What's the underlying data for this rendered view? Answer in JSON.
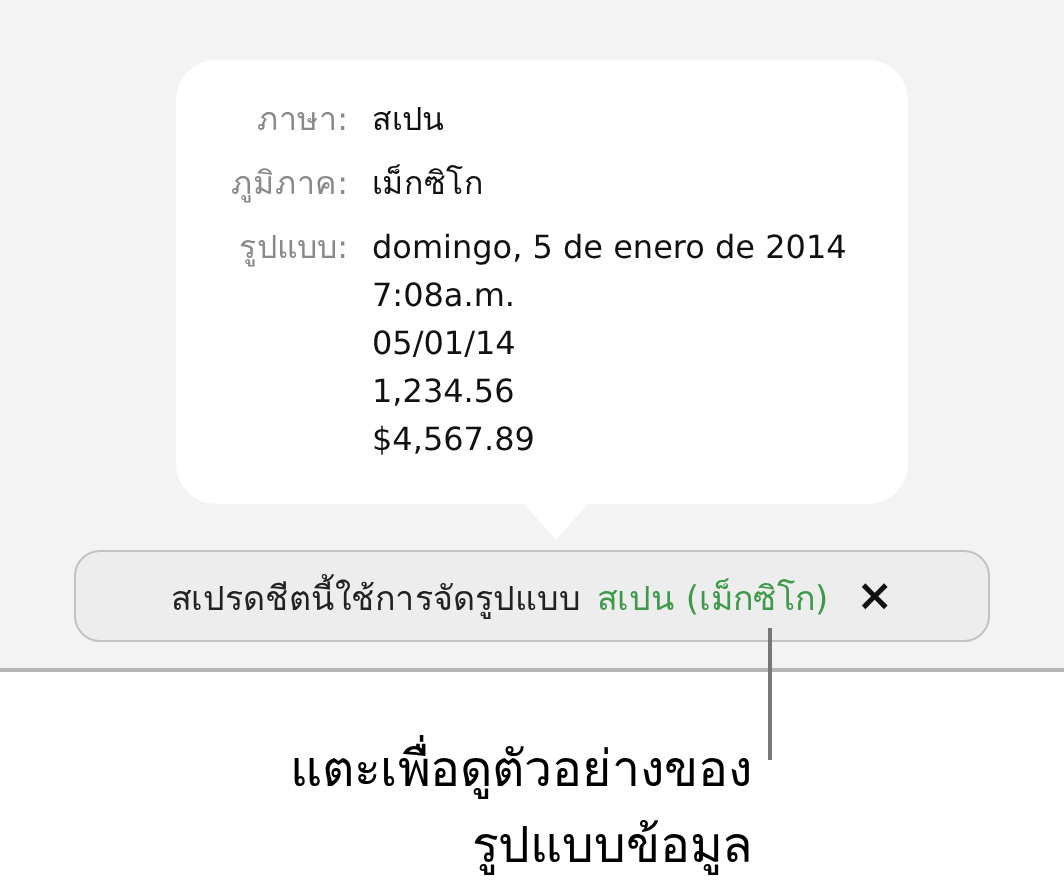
{
  "popover": {
    "rows": [
      {
        "label": "ภาษา:",
        "values": [
          "สเปน"
        ]
      },
      {
        "label": "ภูมิภาค:",
        "values": [
          "เม็กซิโก"
        ]
      },
      {
        "label": "รูปแบบ:",
        "values": [
          "domingo, 5 de enero de 2014",
          "7:08a.m.",
          "05/01/14",
          "1,234.56",
          "$4,567.89"
        ]
      }
    ]
  },
  "banner": {
    "message": "สเปรดชีตนี้ใช้การจัดรูปแบบ",
    "locale_link": "สเปน (เม็กซิโก)",
    "close": "×"
  },
  "callout": {
    "lines": [
      "แตะเพื่อดูตัวอย่างของ",
      "รูปแบบข้อมูล"
    ]
  }
}
